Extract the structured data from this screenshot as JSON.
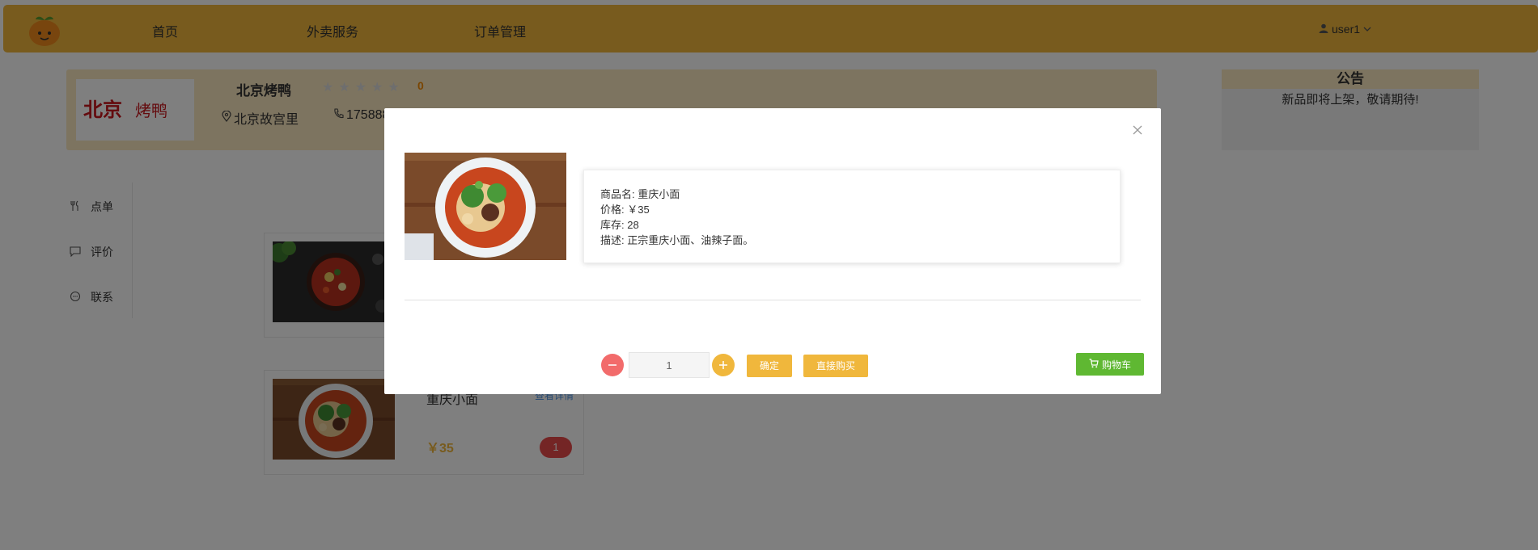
{
  "nav": {
    "items": [
      {
        "label": "首页"
      },
      {
        "label": "外卖服务"
      },
      {
        "label": "订单管理"
      }
    ],
    "user": "user1"
  },
  "shop": {
    "name": "北京烤鸭",
    "rating": "0",
    "address": "北京故宫里",
    "phone": "175888",
    "logo_text": "北京烤鸭"
  },
  "notice": {
    "title": "公告",
    "text": "新品即将上架，敬请期待!"
  },
  "side_menu": [
    {
      "label": "点单",
      "icon": "fork-knife-icon"
    },
    {
      "label": "评价",
      "icon": "comment-icon"
    },
    {
      "label": "联系",
      "icon": "chat-icon"
    }
  ],
  "products": [
    {
      "name": "",
      "price": "",
      "count": ""
    },
    {
      "name": "重庆小面",
      "detail": "查看详情",
      "price": "￥35",
      "count": "1"
    }
  ],
  "modal": {
    "info": [
      "商品名: 重庆小面",
      "价格: ￥35",
      "库存: 28",
      "描述: 正宗重庆小面、油辣子面。"
    ],
    "quantity": "1",
    "confirm_label": "确定",
    "buy_label": "直接购买",
    "cart_label": "购物车"
  },
  "colors": {
    "nav_bg": "#f0b73c",
    "shop_bg": "#fbe8c0",
    "cart_green": "#5fb832",
    "minus_red": "#f26b6b"
  }
}
